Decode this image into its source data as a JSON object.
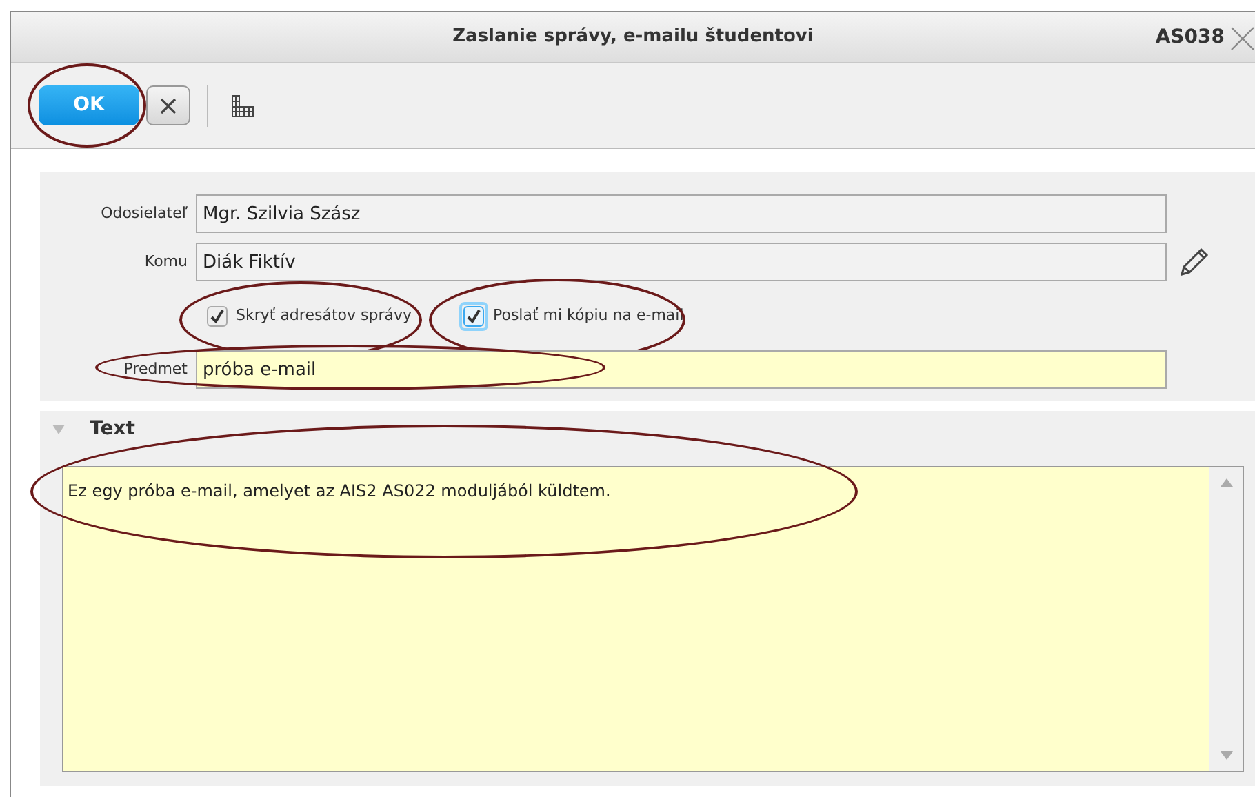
{
  "window": {
    "title": "Zaslanie správy, e-mailu študentovi",
    "code": "AS038"
  },
  "toolbar": {
    "ok_button": {
      "label": "OK",
      "circled": true
    }
  },
  "form": {
    "sender": {
      "label": "Odosielateľ",
      "value": "Mgr. Szilvia Szász"
    },
    "recipient": {
      "label": "Komu",
      "value": "Diák Fiktív"
    },
    "options": [
      {
        "label": "Skryť adresátov správy",
        "checked": true,
        "focused": false,
        "circled": true
      },
      {
        "label": "Poslať mi kópiu na e-mail",
        "checked": true,
        "focused": true,
        "circled": true
      }
    ],
    "subject": {
      "label": "Predmet",
      "value": "próba e-mail",
      "circled": true
    }
  },
  "text_section": {
    "title": "Text",
    "expanded": true,
    "value": "Ez egy próba e-mail, amelyet az AIS2 AS022 moduljából küldtem.",
    "circled": true
  }
}
